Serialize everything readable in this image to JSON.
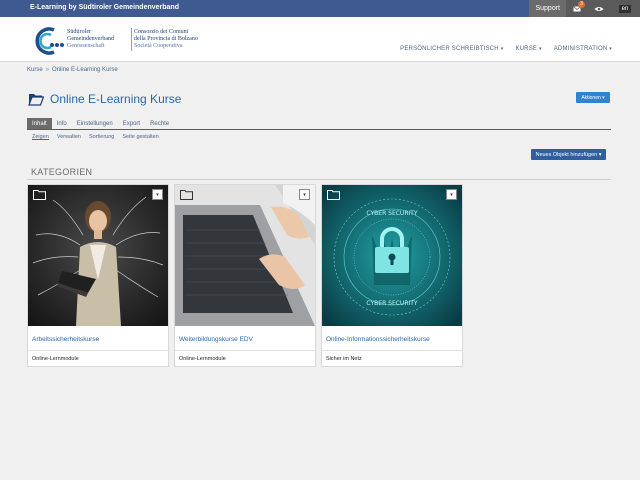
{
  "topbar": {
    "site_title": "E-Learning by Südtiroler Gemeindenverband",
    "support_label": "Support",
    "mail_badge": "3",
    "mail_icon": "envelope-icon",
    "view_icon": "eye-icon",
    "language": "en"
  },
  "logo": {
    "de_line1": "Südtiroler",
    "de_line2": "Gemeindenverband",
    "de_line3": "Genossenschaft",
    "it_line1": "Consorzio dei Comuni",
    "it_line2": "della Provincia di Bolzano",
    "it_line3": "Società Cooperativa"
  },
  "nav": {
    "items": [
      {
        "label": "Persönlicher Schreibtisch"
      },
      {
        "label": "Kurse"
      },
      {
        "label": "Administration"
      }
    ]
  },
  "breadcrumb": {
    "items": [
      "Kurse",
      "Online E-Learning Kurse"
    ]
  },
  "page": {
    "title": "Online E-Learning Kurse",
    "actions_label": "Aktionen",
    "new_object_label": "Neues Objekt hinzufügen"
  },
  "tabs": [
    {
      "label": "Inhalt",
      "active": true
    },
    {
      "label": "Info"
    },
    {
      "label": "Einstellungen"
    },
    {
      "label": "Export"
    },
    {
      "label": "Rechte"
    }
  ],
  "subtabs": [
    {
      "label": "Zeigen",
      "active": true
    },
    {
      "label": "Verwalten"
    },
    {
      "label": "Sortierung"
    },
    {
      "label": "Seite gestalten"
    }
  ],
  "section": {
    "heading": "KATEGORIEN"
  },
  "cards": [
    {
      "title": "Arbeitssicherheitskurse",
      "description": "Online-Lernmodule",
      "image": "businesswoman-with-laptop"
    },
    {
      "title": "Weiterbildungskurse EDV",
      "description": "Online-Lernmodule",
      "image": "hands-typing-on-laptop"
    },
    {
      "title": "Online-Informationssicherheitskurse",
      "description": "Sicher im Netz",
      "image": "cyber-security-padlock"
    }
  ],
  "colors": {
    "topbar": "#3f5a91",
    "title_blue": "#2a67a8",
    "button_blue": "#2e84d1",
    "new_object_blue": "#2e5f9e",
    "teal": "#1b8a8d"
  }
}
